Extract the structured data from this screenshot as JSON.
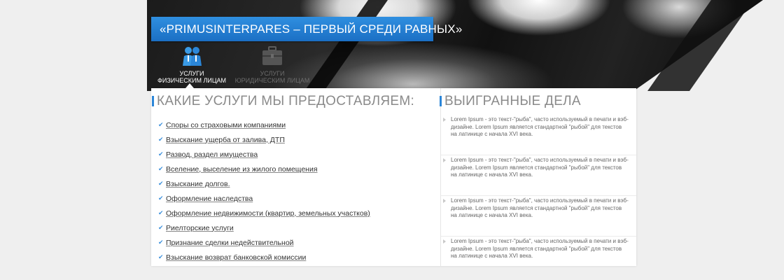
{
  "headline": "«PRIMUSINTERPARES – ПЕРВЫЙ СРЕДИ РАВНЫХ»",
  "tabs": [
    {
      "line1": "УСЛУГИ",
      "line2": "ФИЗИЧЕСКИМ ЛИЦАМ",
      "icon": "people-icon",
      "active": true
    },
    {
      "line1": "УСЛУГИ",
      "line2": "ЮРИДИЧЕСКИМ ЛИЦАМ",
      "icon": "briefcase-icon",
      "active": false
    }
  ],
  "services": {
    "title": "КАКИЕ УСЛУГИ МЫ ПРЕДОСТАВЛЯЕМ:",
    "items": [
      "Споры со страховыми компаниями",
      "Взыскание ущерба от залива, ДТП",
      "Развод, раздел имущества",
      "Вселение, выселение из жилого помещения",
      "Взыскание долгов.",
      "Оформление наследства",
      "Оформление недвижимости (квартир, земельных участков)",
      "Риелторские услуги",
      "Признание сделки недействительной",
      "Взыскание возврат банковской комиссии"
    ]
  },
  "cases": {
    "title": "ВЫИГРАННЫЕ ДЕЛА",
    "items": [
      "Lorem Ipsum - это текст-\"рыба\", часто используемый в печати и вэб-дизайне. Lorem Ipsum является стандартной \"рыбой\" для текстов на латинице с начала XVI века.",
      "Lorem Ipsum - это текст-\"рыба\", часто используемый в печати и вэб-дизайне. Lorem Ipsum является стандартной \"рыбой\" для текстов на латинице с начала XVI века.",
      "Lorem Ipsum - это текст-\"рыба\", часто используемый в печати и вэб-дизайне. Lorem Ipsum является стандартной \"рыбой\" для текстов на латинице с начала XVI века.",
      "Lorem Ipsum - это текст-\"рыба\", часто используемый в печати и вэб-дизайне. Lorem Ipsum является стандартной \"рыбой\" для текстов на латинице с начала XVI века."
    ]
  },
  "colors": {
    "accent": "#2b86d8",
    "headline_bg": "#1f78cf",
    "panel_bg": "#ffffff",
    "page_bg": "#efefef"
  }
}
